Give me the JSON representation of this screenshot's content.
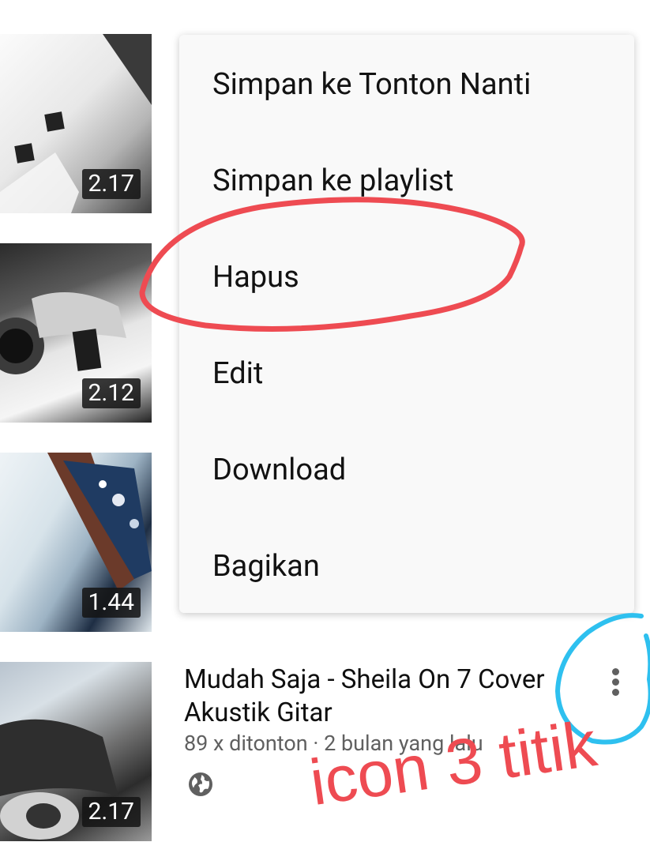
{
  "videos": [
    {
      "duration": "2.17"
    },
    {
      "duration": "2.12"
    },
    {
      "duration": "1.44"
    },
    {
      "duration": "2.17",
      "title": "Mudah Saja - Sheila On 7 Cover Akustik Gitar",
      "meta": "89 x ditonton · 2 bulan yang lalu",
      "visibility_icon": "globe-icon",
      "more_icon": "more-vert-icon"
    }
  ],
  "menu": {
    "items": [
      "Simpan ke Tonton Nanti",
      "Simpan ke playlist",
      "Hapus",
      "Edit",
      "Download",
      "Bagikan"
    ]
  },
  "annotation": {
    "label": "icon 3 titik",
    "color": "#ee4b52",
    "circle_color": "#2ec0ef"
  }
}
